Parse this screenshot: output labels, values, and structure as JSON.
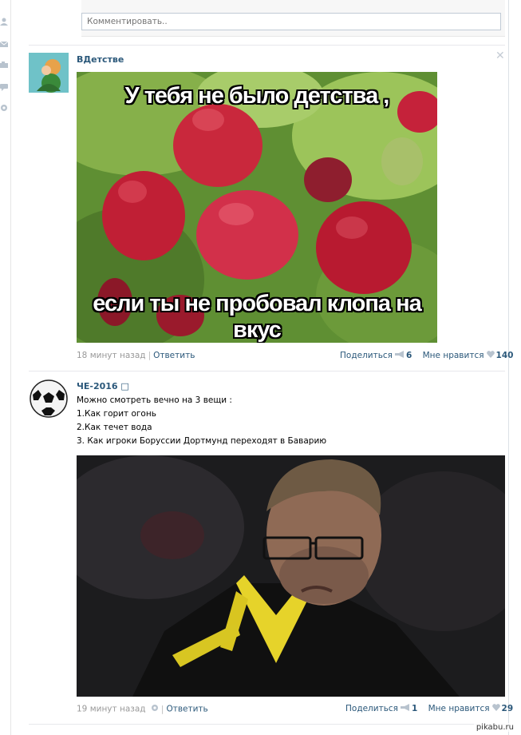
{
  "comment_box": {
    "placeholder": "Комментировать.."
  },
  "posts": [
    {
      "author": "ВДетстве",
      "meme_top": "У тебя не было детства ,",
      "meme_bottom": "если ты не пробовал клопа на вкус",
      "time": "18 минут назад",
      "reply": "Ответить",
      "share_label": "Поделиться",
      "share_count": "6",
      "like_label": "Мне нравится",
      "like_count": "140"
    },
    {
      "author": "ЧЕ-2016 □",
      "lines": [
        "Можно смотреть вечно на 3 вещи :",
        "1.Как горит огонь",
        "2.Как течет вода",
        "3. Как игроки Боруссии Дортмунд переходят в Баварию"
      ],
      "time": "19 минут назад",
      "reply": "Ответить",
      "share_label": "Поделиться",
      "share_count": "1",
      "like_label": "Мне нравится",
      "like_count": "29"
    }
  ],
  "watermark": "pikabu.ru",
  "icons": [
    "user-icon",
    "mail-icon",
    "photo-icon",
    "message-icon",
    "settings-icon",
    "close-icon",
    "megaphone-icon",
    "heart-icon",
    "gear-icon"
  ],
  "colors": {
    "link": "#2b587a",
    "muted": "#999999",
    "icon": "#b8c3ce"
  }
}
